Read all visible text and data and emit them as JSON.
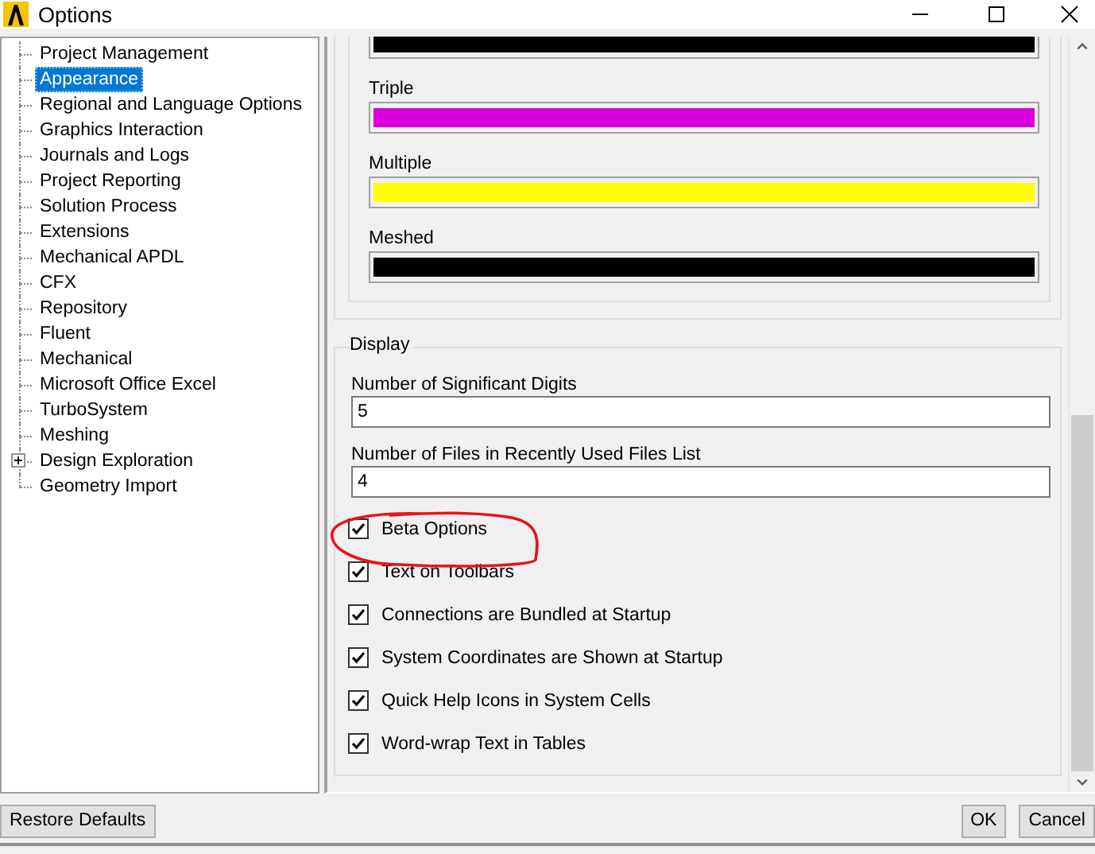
{
  "window": {
    "title": "Options"
  },
  "tree": [
    {
      "label": "Project Management",
      "selected": false,
      "has_children": false
    },
    {
      "label": "Appearance",
      "selected": true,
      "has_children": false
    },
    {
      "label": "Regional and Language Options",
      "selected": false,
      "has_children": false
    },
    {
      "label": "Graphics Interaction",
      "selected": false,
      "has_children": false
    },
    {
      "label": "Journals and Logs",
      "selected": false,
      "has_children": false
    },
    {
      "label": "Project Reporting",
      "selected": false,
      "has_children": false
    },
    {
      "label": "Solution Process",
      "selected": false,
      "has_children": false
    },
    {
      "label": "Extensions",
      "selected": false,
      "has_children": false
    },
    {
      "label": "Mechanical APDL",
      "selected": false,
      "has_children": false
    },
    {
      "label": "CFX",
      "selected": false,
      "has_children": false
    },
    {
      "label": "Repository",
      "selected": false,
      "has_children": false
    },
    {
      "label": "Fluent",
      "selected": false,
      "has_children": false
    },
    {
      "label": "Mechanical",
      "selected": false,
      "has_children": false
    },
    {
      "label": "Microsoft Office Excel",
      "selected": false,
      "has_children": false
    },
    {
      "label": "TurboSystem",
      "selected": false,
      "has_children": false
    },
    {
      "label": "Meshing",
      "selected": false,
      "has_children": false
    },
    {
      "label": "Design Exploration",
      "selected": false,
      "has_children": true
    },
    {
      "label": "Geometry Import",
      "selected": false,
      "has_children": false
    }
  ],
  "colors": [
    {
      "color": "#000000"
    },
    {
      "label": "Triple",
      "color": "#d800d8"
    },
    {
      "label": "Multiple",
      "color": "#ffff00"
    },
    {
      "label": "Meshed",
      "color": "#000000"
    }
  ],
  "display": {
    "title": "Display",
    "fields": [
      {
        "label": "Number of Significant Digits",
        "value": "5"
      },
      {
        "label": "Number of Files in Recently Used Files List",
        "value": "4"
      }
    ],
    "checkboxes": [
      {
        "label": "Beta Options",
        "checked": true
      },
      {
        "label": "Text on Toolbars",
        "checked": true
      },
      {
        "label": "Connections are Bundled at Startup",
        "checked": true
      },
      {
        "label": "System Coordinates are Shown at Startup",
        "checked": true
      },
      {
        "label": "Quick Help Icons in System Cells",
        "checked": true
      },
      {
        "label": "Word-wrap Text in Tables",
        "checked": true
      }
    ]
  },
  "buttons": [
    {
      "label": "Restore Defaults",
      "kind": "left"
    },
    {
      "label": "OK",
      "kind": "right"
    },
    {
      "label": "Cancel",
      "kind": "right"
    }
  ]
}
